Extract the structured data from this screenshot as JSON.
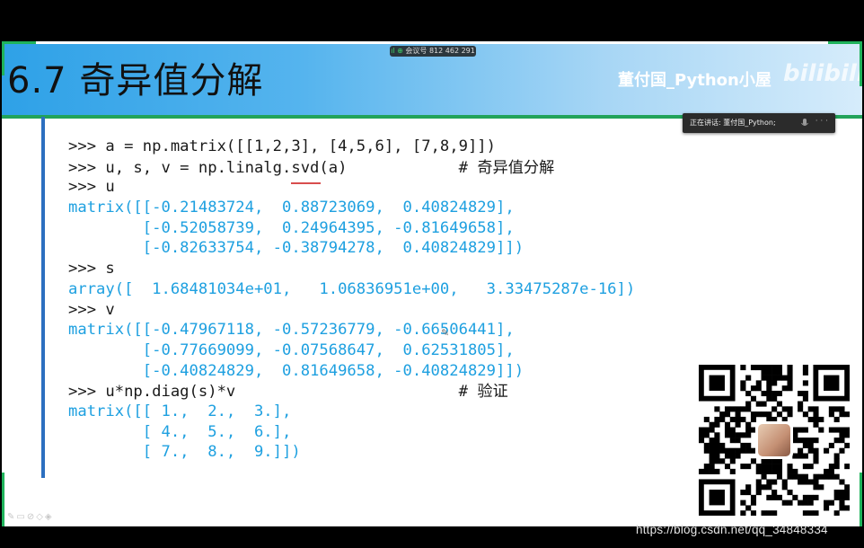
{
  "slide": {
    "title": "6.7  奇异值分解",
    "channel": "董付国_Python小屋",
    "site_logo": "bilibili"
  },
  "meeting": {
    "signal": "ıl ⊕",
    "id_label": "会议号 812 462 291",
    "speaker": "正在讲话: 董付国_Python;",
    "more": "· · ·"
  },
  "code_lines": [
    {
      "kind": "in",
      "text": ">>> a = np.matrix([[1,2,3], [4,5,6], [7,8,9]])",
      "comment": ""
    },
    {
      "kind": "in",
      "text": ">>> u, s, v = np.linalg.svd(a)            # ",
      "comment": "奇异值分解"
    },
    {
      "kind": "in",
      "text": ">>> u",
      "comment": ""
    },
    {
      "kind": "out",
      "text": "matrix([[-0.21483724,  0.88723069,  0.40824829],",
      "comment": ""
    },
    {
      "kind": "out",
      "text": "        [-0.52058739,  0.24964395, -0.81649658],",
      "comment": ""
    },
    {
      "kind": "out",
      "text": "        [-0.82633754, -0.38794278,  0.40824829]])",
      "comment": ""
    },
    {
      "kind": "in",
      "text": ">>> s",
      "comment": ""
    },
    {
      "kind": "out",
      "text": "array([  1.68481034e+01,   1.06836951e+00,   3.33475287e-16])",
      "comment": ""
    },
    {
      "kind": "in",
      "text": ">>> v",
      "comment": ""
    },
    {
      "kind": "out",
      "text": "matrix([[-0.47967118, -0.57236779, -0.66506441],",
      "comment": ""
    },
    {
      "kind": "out",
      "text": "        [-0.77669099, -0.07568647,  0.62531805],",
      "comment": ""
    },
    {
      "kind": "out",
      "text": "        [-0.40824829,  0.81649658, -0.40824829]])",
      "comment": ""
    },
    {
      "kind": "in",
      "text": ">>> u*np.diag(s)*v                        # ",
      "comment": "验证"
    },
    {
      "kind": "out",
      "text": "matrix([[ 1.,  2.,  3.],",
      "comment": ""
    },
    {
      "kind": "out",
      "text": "        [ 4.,  5.,  6.],",
      "comment": ""
    },
    {
      "kind": "out",
      "text": "        [ 7.,  8.,  9.]])",
      "comment": ""
    }
  ],
  "tool_icons": "✎▭⊘◇◈",
  "watermark": "https://blog.csdn.net/qq_34848334",
  "colors": {
    "code_prompt": "#1a1a1a",
    "code_output": "#1ea0e0",
    "title_band_start": "#2ea1e7",
    "accent_green": "#1fb35b",
    "code_bar": "#2c6fc0"
  },
  "icons": [
    "signal-icon",
    "mic-icon",
    "more-icon",
    "qr-code",
    "pen-cursor-icon"
  ]
}
